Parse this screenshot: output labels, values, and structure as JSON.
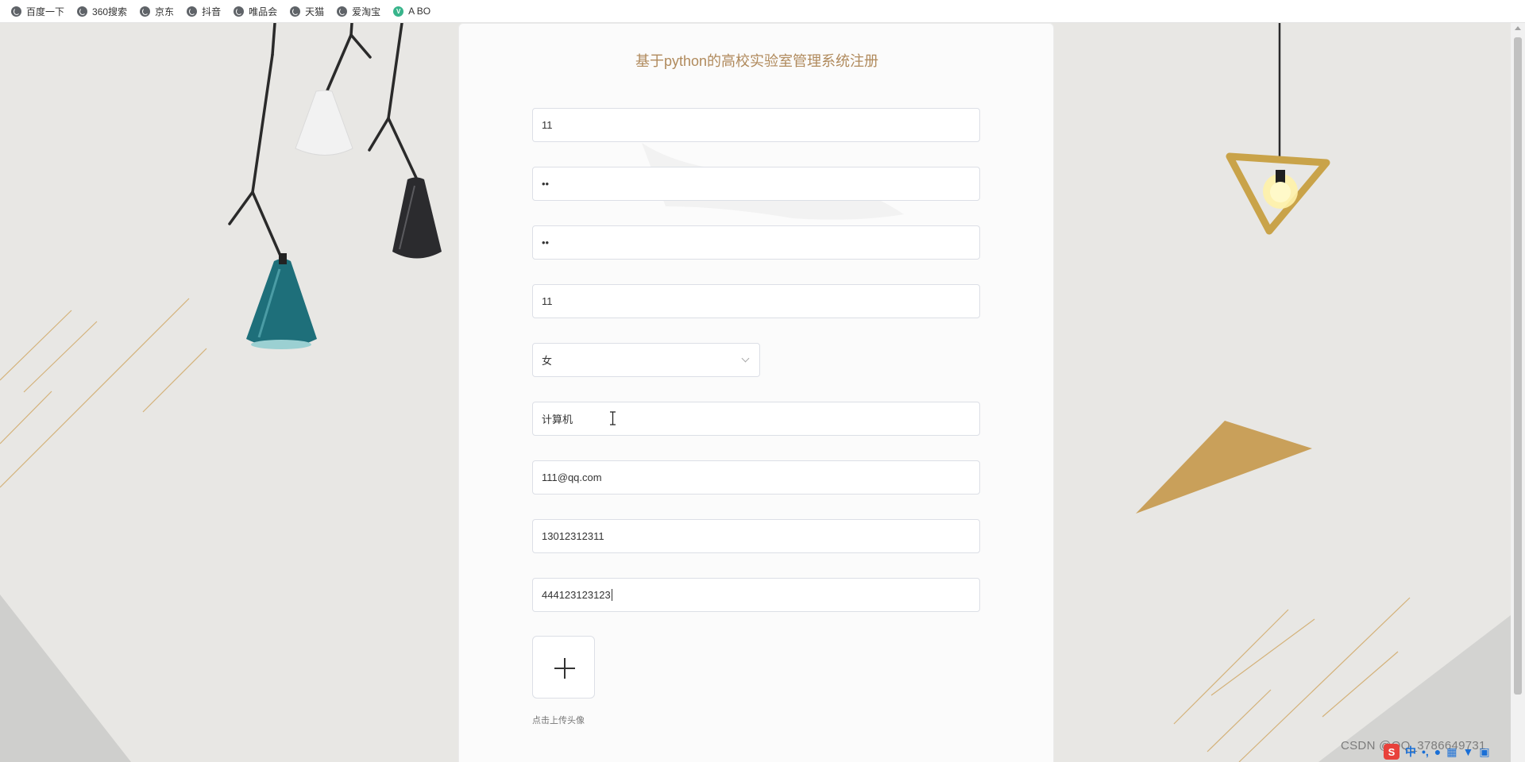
{
  "bookmarks": [
    {
      "label": "百度一下",
      "icon": "globe-icon"
    },
    {
      "label": "360搜索",
      "icon": "globe-icon"
    },
    {
      "label": "京东",
      "icon": "globe-icon"
    },
    {
      "label": "抖音",
      "icon": "globe-icon"
    },
    {
      "label": "唯品会",
      "icon": "globe-icon"
    },
    {
      "label": "天猫",
      "icon": "globe-icon"
    },
    {
      "label": "爱淘宝",
      "icon": "globe-icon"
    },
    {
      "label": "A BO",
      "icon": "v-icon"
    }
  ],
  "form": {
    "title": "基于python的高校实验室管理系统注册",
    "fields": {
      "account": "11",
      "password": "••",
      "confirm_password": "••",
      "name": "11",
      "gender": "女",
      "major": "计算机",
      "email": "111@qq.com",
      "phone": "13012312311",
      "id_number": "444123123123"
    },
    "upload_hint": "点击上传头像"
  },
  "watermark": "CSDN @QQ_3786649731",
  "ime": {
    "logo": "S",
    "lang": "中"
  },
  "colors": {
    "title": "#b08a5c",
    "background": "#e8e7e4",
    "card": "#fbfbfb",
    "accent_gold": "#c9a05a",
    "teal_lamp": "#1e6f7a"
  }
}
